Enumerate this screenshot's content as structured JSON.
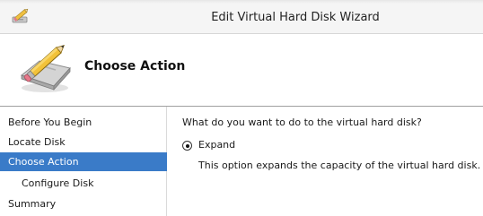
{
  "window": {
    "title": "Edit Virtual Hard Disk Wizard"
  },
  "header": {
    "title": "Choose Action",
    "icon": "disk-pencil-icon"
  },
  "sidebar": {
    "items": [
      {
        "label": "Before You Begin",
        "active": false,
        "indent": false
      },
      {
        "label": "Locate Disk",
        "active": false,
        "indent": false
      },
      {
        "label": "Choose Action",
        "active": true,
        "indent": false
      },
      {
        "label": "Configure Disk",
        "active": false,
        "indent": true
      },
      {
        "label": "Summary",
        "active": false,
        "indent": false
      }
    ]
  },
  "main": {
    "question": "What do you want to do to the virtual hard disk?",
    "options": [
      {
        "label": "Expand",
        "selected": true,
        "description": "This option expands the capacity of the virtual hard disk."
      }
    ]
  },
  "colors": {
    "accent": "#3a7bc8"
  }
}
